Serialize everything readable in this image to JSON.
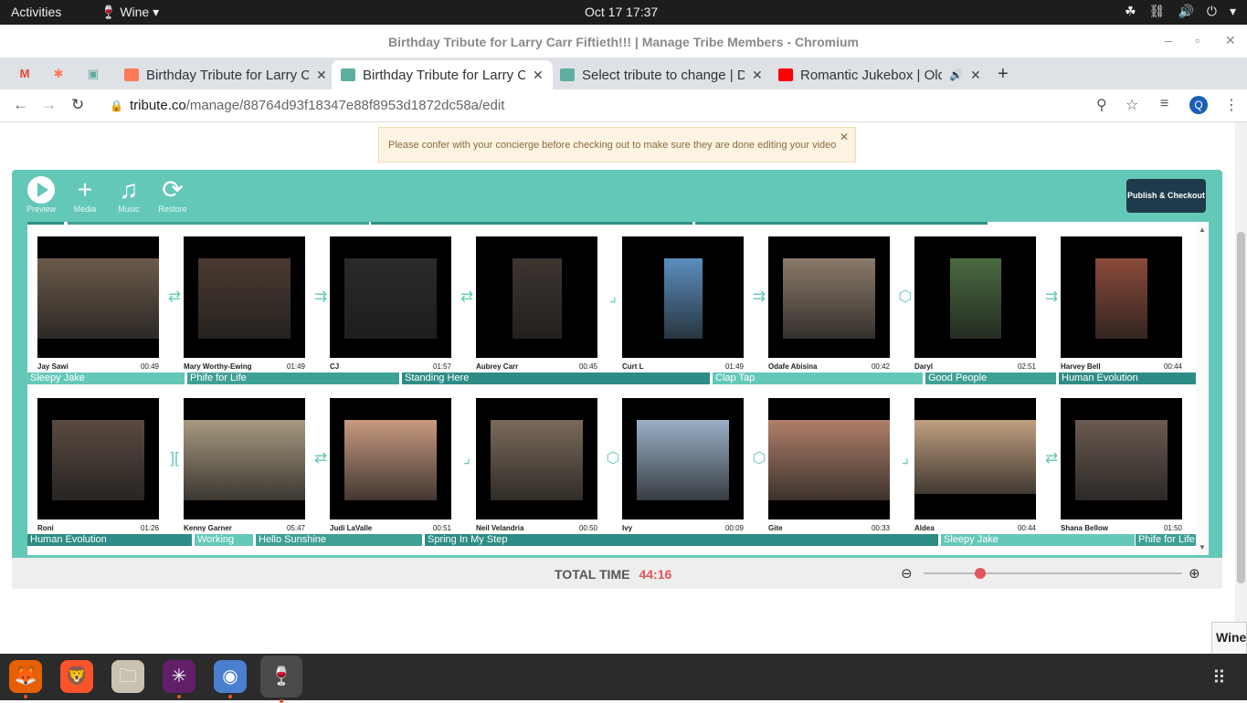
{
  "topbar": {
    "activities": "Activities",
    "app": "🍷 Wine ▾",
    "clock": "Oct 17  17:37",
    "tray": [
      "☘",
      "⛓",
      "🔊",
      "⏻",
      "▾"
    ]
  },
  "window": {
    "title": "Birthday Tribute for Larry Carr Fiftieth!!! | Manage Tribe Members - Chromium",
    "controls": [
      "–",
      "▫",
      "✕"
    ]
  },
  "tabs": [
    {
      "label": "Birthday Tribute for Larry Carr Fiftieth!!!",
      "active": false,
      "favicon_color": "#ff7a59"
    },
    {
      "label": "Birthday Tribute for Larry Carr Fiftieth!!!",
      "active": true,
      "favicon_color": "#5fae9f"
    },
    {
      "label": "Select tribute to change | Django site admin",
      "active": false,
      "favicon_color": "#5fae9f"
    },
    {
      "label": "Romantic Jukebox | Old School R&B Love Songs",
      "active": false,
      "favicon_color": "#ff0000"
    }
  ],
  "pinned": [
    "M",
    "✱",
    "▣"
  ],
  "address": {
    "domain": "tribute.co",
    "path": "/manage/88764d93f18347e88f8953d1872dc58a/edit"
  },
  "profile_initial": "Q",
  "notice": {
    "text": "Please confer with your concierge before checking out to make sure they are done editing your video",
    "close": "✕"
  },
  "editor": {
    "tools": [
      {
        "label": "Preview",
        "icon": "play-icon"
      },
      {
        "label": "Media",
        "icon": "plus-icon",
        "glyph": "+"
      },
      {
        "label": "Music",
        "icon": "music-icon",
        "glyph": "♫"
      },
      {
        "label": "Restore",
        "icon": "restore-icon",
        "glyph": "⟳"
      }
    ],
    "publish_label": "Publish & Checkout"
  },
  "row1": [
    {
      "name": "Jay Sawi",
      "time": "00:49",
      "bg": "#6b5a4a"
    },
    {
      "name": "Mary Worthy-Ewing",
      "time": "01:49",
      "bg": "#4a3a30"
    },
    {
      "name": "CJ",
      "time": "01:57",
      "bg": "#2a2a2a"
    },
    {
      "name": "Aubrey Carr",
      "time": "00:45",
      "bg": "#3d3530"
    },
    {
      "name": "Curt L",
      "time": "01:49",
      "bg": "#5a8fbf"
    },
    {
      "name": "Odafe Abisina",
      "time": "00:42",
      "bg": "#8c7a6a"
    },
    {
      "name": "Daryl",
      "time": "02:51",
      "bg": "#4a6a40"
    },
    {
      "name": "Harvey Bell",
      "time": "00:44",
      "bg": "#8a4a3a"
    }
  ],
  "row1_transitions": [
    "⇄",
    "⇉",
    "⇄",
    "⌟",
    "⇉",
    "⬡",
    "⇉"
  ],
  "row1_music": [
    "Sleepy Jake",
    "Phife for Life",
    "Standing Here",
    "Clap Tap",
    "Good People",
    "Human Evolution"
  ],
  "row2": [
    {
      "name": "Roni",
      "time": "01:26",
      "bg": "#5a4a40"
    },
    {
      "name": "Kenny Garner",
      "time": "05:47",
      "bg": "#a89a80"
    },
    {
      "name": "Judi LaValle",
      "time": "00:51",
      "bg": "#c89a80"
    },
    {
      "name": "Neil Velandria",
      "time": "00:50",
      "bg": "#7a6a5a"
    },
    {
      "name": "Ivy",
      "time": "00:09",
      "bg": "#9ab0c8"
    },
    {
      "name": "Gite",
      "time": "00:33",
      "bg": "#b0806a"
    },
    {
      "name": "Aldea",
      "time": "00:44",
      "bg": "#c0a080"
    },
    {
      "name": "Shana Bellow",
      "time": "01:50",
      "bg": "#6a5a50"
    }
  ],
  "row2_transitions": [
    "][",
    "⇄",
    "⌟",
    "⬡",
    "⬡",
    "⌟",
    "⇄"
  ],
  "row2_music": [
    "Human Evolution",
    "Working",
    "Hello Sunshine",
    "Spring In My Step",
    "Sleepy Jake",
    "Phife for Life"
  ],
  "footer": {
    "total_label": "TOTAL TIME",
    "total_value": "44:16",
    "zoom_level": 0.22
  },
  "wine_popup": "Wine",
  "dock": [
    {
      "name": "firefox",
      "glyph": "🦊",
      "color": "#e66000",
      "running": true
    },
    {
      "name": "brave",
      "glyph": "🦁",
      "color": "#fb542b",
      "running": false
    },
    {
      "name": "files",
      "glyph": "🗀",
      "color": "#c8c2b0",
      "running": false
    },
    {
      "name": "slack",
      "glyph": "✳",
      "color": "#611f69",
      "running": true
    },
    {
      "name": "chromium",
      "glyph": "◉",
      "color": "#4a7fd0",
      "running": true
    },
    {
      "name": "wine",
      "glyph": "🍷",
      "color": "#4a4a4a",
      "running": true
    }
  ]
}
